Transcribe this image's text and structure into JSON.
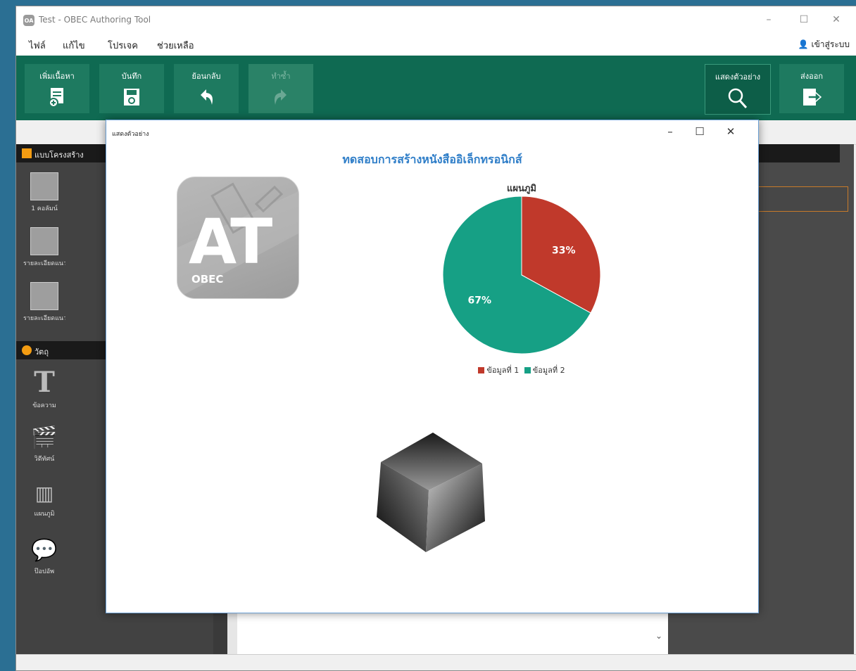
{
  "window": {
    "title": "Test - OBEC Authoring Tool"
  },
  "menu": {
    "items": [
      "ไฟล์",
      "แก้ไข",
      "โปรเจค",
      "ช่วยเหลือ"
    ],
    "login": "เข้าสู่ระบบ"
  },
  "toolbar": {
    "add_content": "เพิ่มเนื้อหา",
    "save": "บันทึก",
    "undo": "ย้อนกลับ",
    "redo": "ทำซ้ำ",
    "preview": "แสดงตัวอย่าง",
    "export": "ส่งออก"
  },
  "left_panel": {
    "layout_header": "แบบโครงสร้าง",
    "layout_tiles": [
      "1 คอลัมน์",
      "รายละเอียดแนวนอน",
      "รายละเอียดแนวยาว"
    ],
    "objects_header": "วัตถุ",
    "object_tiles": [
      "ข้อความ",
      "วิดีทัศน์",
      "แผนภูมิ",
      "ป๊อปอัพ"
    ]
  },
  "preview": {
    "window_title": "แสดงตัวอย่าง",
    "heading": "ทดสอบการสร้างหนังสืออิเล็กทรอนิกส์",
    "logo": {
      "letters": "AT",
      "sub": "OBEC"
    }
  },
  "chart_data": {
    "type": "pie",
    "title": "แผนภูมิ",
    "categories": [
      "ข้อมูลที่ 1",
      "ข้อมูลที่ 2"
    ],
    "values": [
      33,
      67
    ],
    "labels": [
      "33%",
      "67%"
    ],
    "colors": [
      "#c0392b",
      "#16a085"
    ],
    "legend": "bottom"
  }
}
